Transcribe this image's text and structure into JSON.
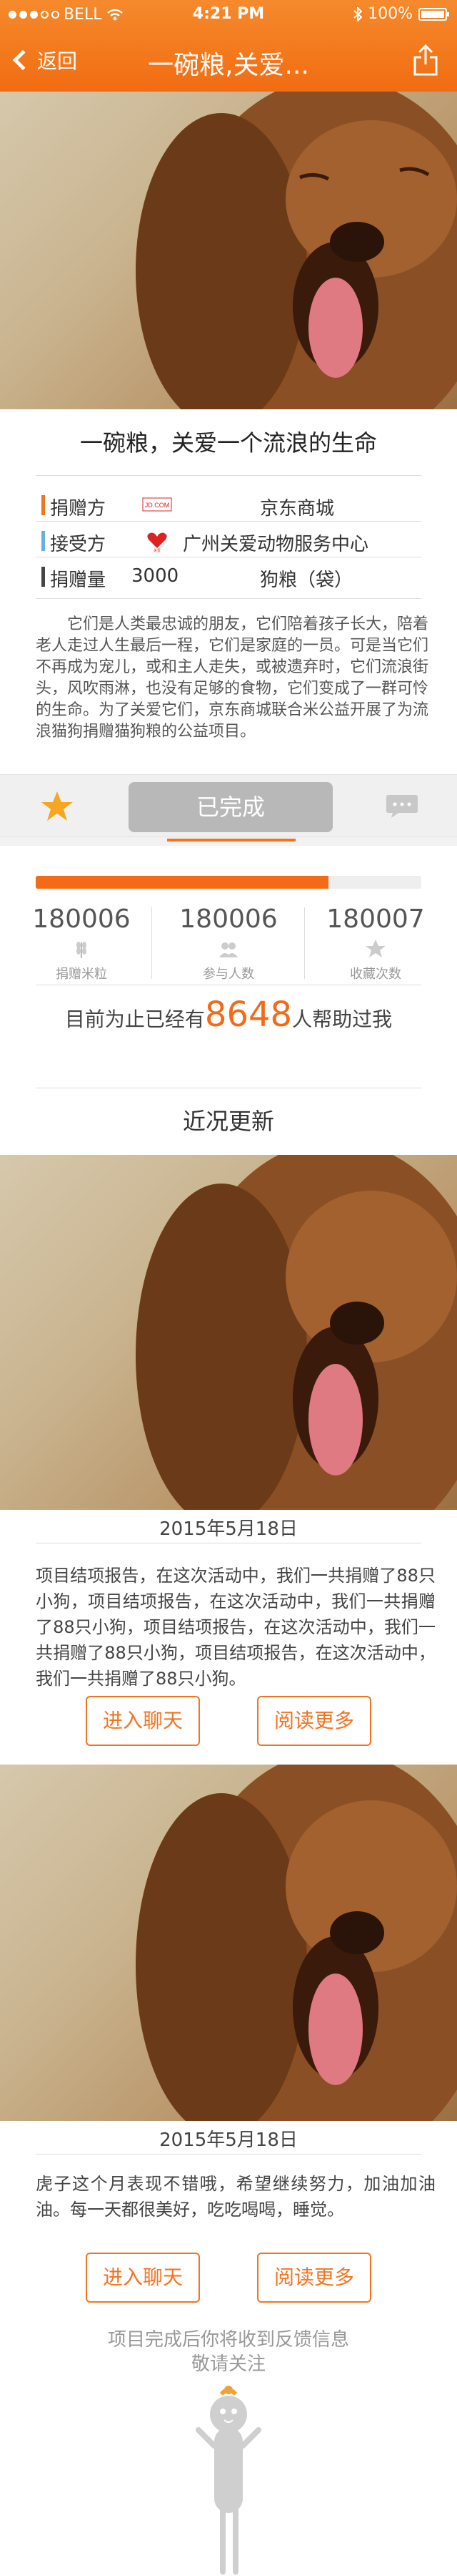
{
  "status_bar": {
    "carrier": "BELL",
    "time": "4:21 PM",
    "battery": "100%"
  },
  "nav": {
    "back_label": "返回",
    "title": "一碗粮,关爱..."
  },
  "project": {
    "title": "一碗粮，关爱一个流浪的生命",
    "info": [
      {
        "label": "捐赠方",
        "value": "京东商城",
        "logo_text": "JD.COM",
        "accent": "#f37420"
      },
      {
        "label": "接受方",
        "value": "广州关爱动物服务中心",
        "logo_text": "关爱",
        "accent": "#6aaee0"
      },
      {
        "label": "捐赠量",
        "value": "3000",
        "unit": "狗粮（袋）",
        "accent": "#444444"
      }
    ],
    "description": "它们是人类最忠诚的朋友，它们陪着孩子长大，陪着老人走过人生最后一程，它们是家庭的一员。可是当它们不再成为宠儿，或和主人走失，或被遗弃时，它们流浪街头，风吹雨淋，也没有足够的食物，它们变成了一群可怜的生命。为了关爱它们，京东商城联合米公益开展了为流浪猫狗捐赠猫狗粮的公益项目。"
  },
  "actions": {
    "favorite_icon": "star-icon",
    "status_button": "已完成",
    "comment_icon": "chat-bubble-icon"
  },
  "progress": {
    "fraction": 0.76
  },
  "stats": [
    {
      "value": "180006",
      "label": "捐赠米粒",
      "icon": "wheat-icon"
    },
    {
      "value": "180006",
      "label": "参与人数",
      "icon": "people-icon"
    },
    {
      "value": "180007",
      "label": "收藏次数",
      "icon": "star-icon"
    }
  ],
  "helped": {
    "prefix": "目前为止已经有",
    "count": "8648",
    "suffix": "人帮助过我"
  },
  "recent_heading": "近况更新",
  "updates": [
    {
      "date": "2015年5月18日",
      "text": "项目结项报告，在这次活动中，我们一共捐赠了88只小狗，项目结项报告，在这次活动中，我们一共捐赠了88只小狗，项目结项报告，在这次活动中，我们一共捐赠了88只小狗，项目结项报告，在这次活动中，我们一共捐赠了88只小狗。",
      "chat_button": "进入聊天",
      "read_button": "阅读更多"
    },
    {
      "date": "2015年5月18日",
      "text": "虎子这个月表现不错哦，希望继续努力，加油加油油。每一天都很美好，吃吃喝喝，睡觉。",
      "chat_button": "进入聊天",
      "read_button": "阅读更多"
    }
  ],
  "footer": {
    "line1": "项目完成后你将收到反馈信息",
    "line2": "敬请关注"
  },
  "colors": {
    "brand": "#f37420",
    "done_button": "#b8b8b8"
  }
}
